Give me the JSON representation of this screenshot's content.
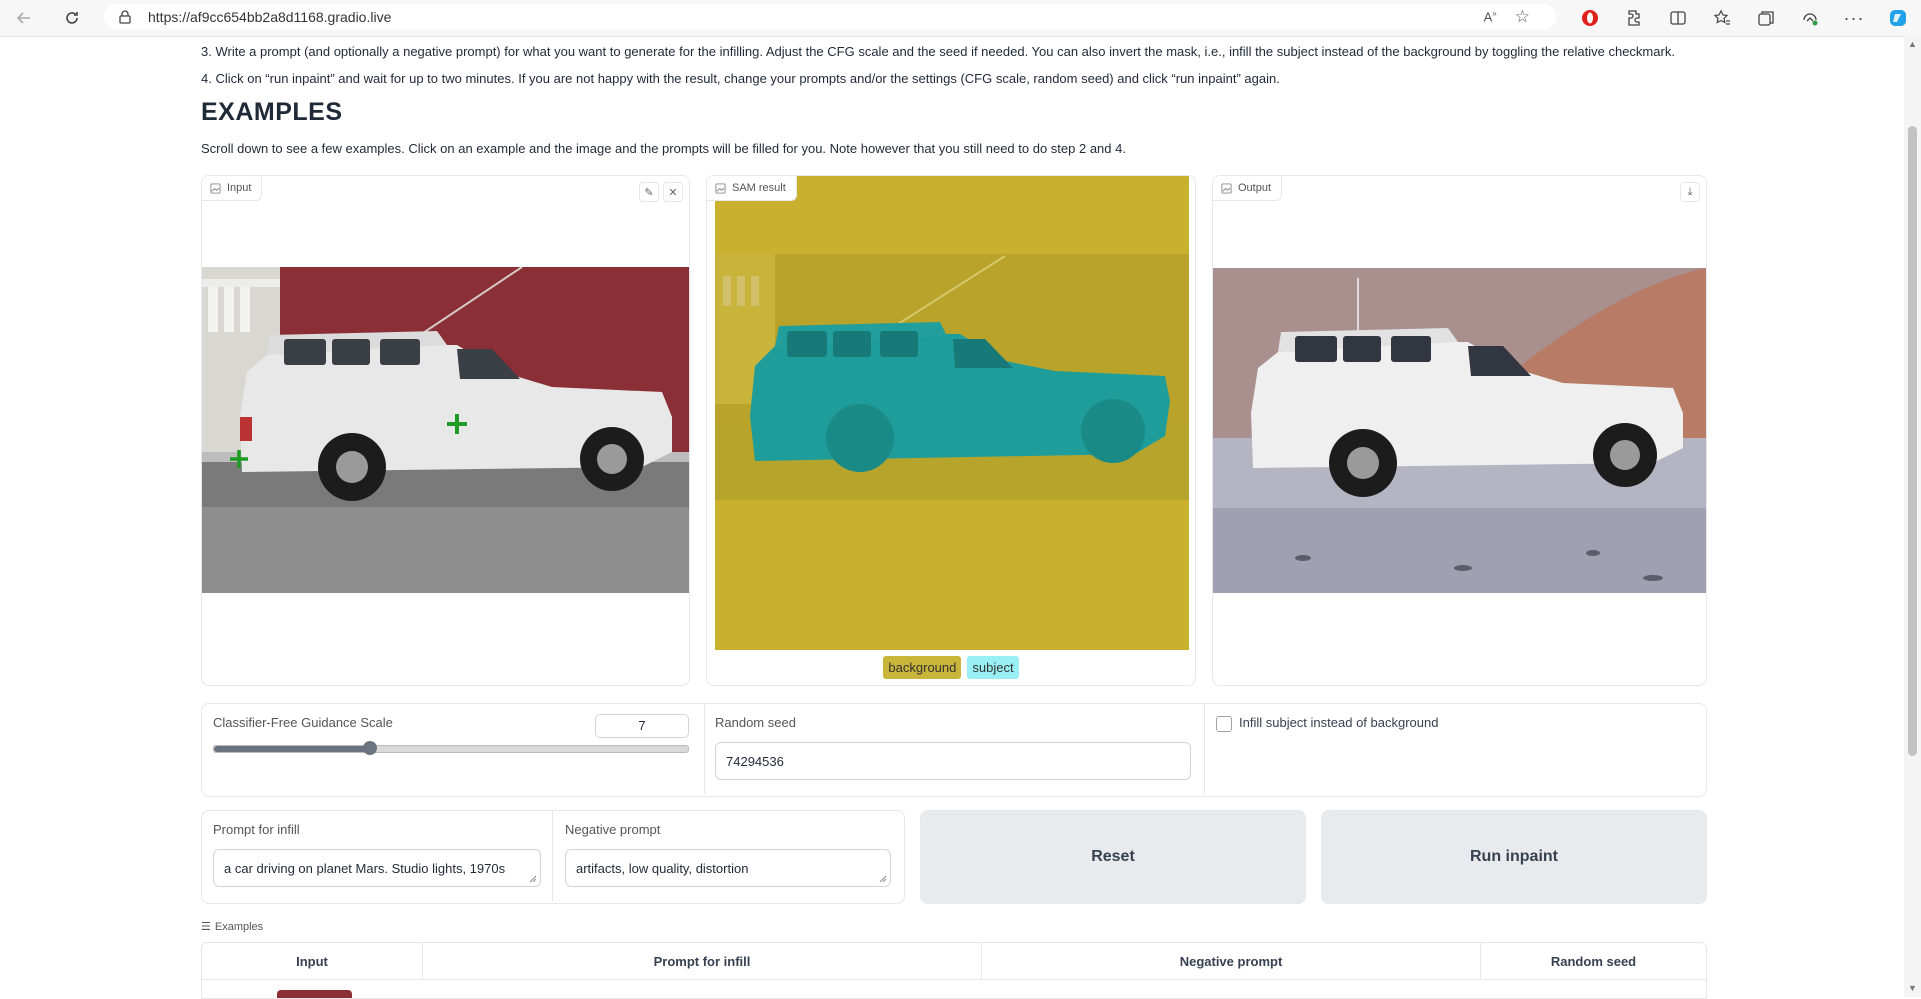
{
  "browser": {
    "url": "https://af9cc654bb2a8d1168.gradio.live"
  },
  "instructions": {
    "step3": "3. Write a prompt (and optionally a negative prompt) for what you want to generate for the infilling. Adjust the CFG scale and the seed if needed. You can also invert the mask, i.e., infill the subject instead of the background by toggling the relative checkmark.",
    "step4": "4. Click on “run inpaint” and wait for up to two minutes. If you are not happy with the result, change your prompts and/or the settings (CFG scale, random seed) and click “run inpaint” again."
  },
  "examples_section": {
    "title": "EXAMPLES",
    "description": "Scroll down to see a few examples. Click on an example and the image and the prompts will be filled for you. Note however that you still need to do step 2 and 4."
  },
  "panels": {
    "input_label": "Input",
    "sam_label": "SAM result",
    "output_label": "Output"
  },
  "legend": {
    "background": "background",
    "subject": "subject",
    "background_color": "#c9b53a",
    "subject_color": "#99f0f4"
  },
  "controls": {
    "cfg_label": "Classifier-Free Guidance Scale",
    "cfg_value": "7",
    "cfg_fraction": 0.33,
    "seed_label": "Random seed",
    "seed_value": "74294536",
    "invert_label": "Infill subject instead of background",
    "invert_checked": false,
    "prompt_label": "Prompt for infill",
    "prompt_value": "a car driving on planet Mars. Studio lights, 1970s",
    "negative_label": "Negative prompt",
    "negative_value": "artifacts, low quality, distortion",
    "reset_label": "Reset",
    "run_label": "Run inpaint"
  },
  "examples_table": {
    "label": "Examples",
    "headers": [
      "Input",
      "Prompt for infill",
      "Negative prompt",
      "Random seed"
    ]
  }
}
